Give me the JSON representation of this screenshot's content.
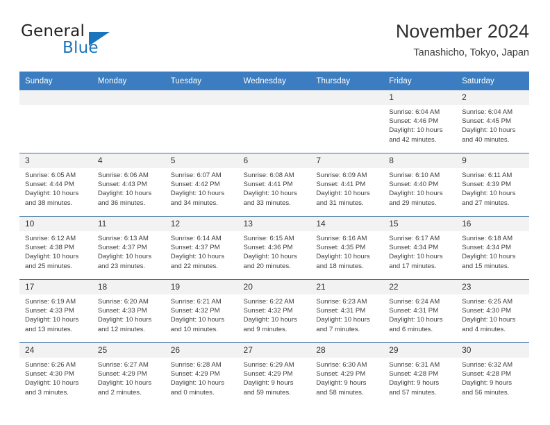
{
  "logo": {
    "word1": "General",
    "word2": "Blue",
    "triangle_color": "#1b75bc"
  },
  "header": {
    "title": "November 2024",
    "location": "Tanashicho, Tokyo, Japan",
    "header_bg": "#3b7dc0",
    "daynum_bg": "#f2f2f2"
  },
  "weekdays": [
    "Sunday",
    "Monday",
    "Tuesday",
    "Wednesday",
    "Thursday",
    "Friday",
    "Saturday"
  ],
  "weeks": [
    [
      {
        "day": "",
        "sunrise": "",
        "sunset": "",
        "daylight": "",
        "daylight2": "",
        "empty": true
      },
      {
        "day": "",
        "sunrise": "",
        "sunset": "",
        "daylight": "",
        "daylight2": "",
        "empty": true
      },
      {
        "day": "",
        "sunrise": "",
        "sunset": "",
        "daylight": "",
        "daylight2": "",
        "empty": true
      },
      {
        "day": "",
        "sunrise": "",
        "sunset": "",
        "daylight": "",
        "daylight2": "",
        "empty": true
      },
      {
        "day": "",
        "sunrise": "",
        "sunset": "",
        "daylight": "",
        "daylight2": "",
        "empty": true
      },
      {
        "day": "1",
        "sunrise": "Sunrise: 6:04 AM",
        "sunset": "Sunset: 4:46 PM",
        "daylight": "Daylight: 10 hours",
        "daylight2": "and 42 minutes.",
        "empty": false
      },
      {
        "day": "2",
        "sunrise": "Sunrise: 6:04 AM",
        "sunset": "Sunset: 4:45 PM",
        "daylight": "Daylight: 10 hours",
        "daylight2": "and 40 minutes.",
        "empty": false
      }
    ],
    [
      {
        "day": "3",
        "sunrise": "Sunrise: 6:05 AM",
        "sunset": "Sunset: 4:44 PM",
        "daylight": "Daylight: 10 hours",
        "daylight2": "and 38 minutes.",
        "empty": false
      },
      {
        "day": "4",
        "sunrise": "Sunrise: 6:06 AM",
        "sunset": "Sunset: 4:43 PM",
        "daylight": "Daylight: 10 hours",
        "daylight2": "and 36 minutes.",
        "empty": false
      },
      {
        "day": "5",
        "sunrise": "Sunrise: 6:07 AM",
        "sunset": "Sunset: 4:42 PM",
        "daylight": "Daylight: 10 hours",
        "daylight2": "and 34 minutes.",
        "empty": false
      },
      {
        "day": "6",
        "sunrise": "Sunrise: 6:08 AM",
        "sunset": "Sunset: 4:41 PM",
        "daylight": "Daylight: 10 hours",
        "daylight2": "and 33 minutes.",
        "empty": false
      },
      {
        "day": "7",
        "sunrise": "Sunrise: 6:09 AM",
        "sunset": "Sunset: 4:41 PM",
        "daylight": "Daylight: 10 hours",
        "daylight2": "and 31 minutes.",
        "empty": false
      },
      {
        "day": "8",
        "sunrise": "Sunrise: 6:10 AM",
        "sunset": "Sunset: 4:40 PM",
        "daylight": "Daylight: 10 hours",
        "daylight2": "and 29 minutes.",
        "empty": false
      },
      {
        "day": "9",
        "sunrise": "Sunrise: 6:11 AM",
        "sunset": "Sunset: 4:39 PM",
        "daylight": "Daylight: 10 hours",
        "daylight2": "and 27 minutes.",
        "empty": false
      }
    ],
    [
      {
        "day": "10",
        "sunrise": "Sunrise: 6:12 AM",
        "sunset": "Sunset: 4:38 PM",
        "daylight": "Daylight: 10 hours",
        "daylight2": "and 25 minutes.",
        "empty": false
      },
      {
        "day": "11",
        "sunrise": "Sunrise: 6:13 AM",
        "sunset": "Sunset: 4:37 PM",
        "daylight": "Daylight: 10 hours",
        "daylight2": "and 23 minutes.",
        "empty": false
      },
      {
        "day": "12",
        "sunrise": "Sunrise: 6:14 AM",
        "sunset": "Sunset: 4:37 PM",
        "daylight": "Daylight: 10 hours",
        "daylight2": "and 22 minutes.",
        "empty": false
      },
      {
        "day": "13",
        "sunrise": "Sunrise: 6:15 AM",
        "sunset": "Sunset: 4:36 PM",
        "daylight": "Daylight: 10 hours",
        "daylight2": "and 20 minutes.",
        "empty": false
      },
      {
        "day": "14",
        "sunrise": "Sunrise: 6:16 AM",
        "sunset": "Sunset: 4:35 PM",
        "daylight": "Daylight: 10 hours",
        "daylight2": "and 18 minutes.",
        "empty": false
      },
      {
        "day": "15",
        "sunrise": "Sunrise: 6:17 AM",
        "sunset": "Sunset: 4:34 PM",
        "daylight": "Daylight: 10 hours",
        "daylight2": "and 17 minutes.",
        "empty": false
      },
      {
        "day": "16",
        "sunrise": "Sunrise: 6:18 AM",
        "sunset": "Sunset: 4:34 PM",
        "daylight": "Daylight: 10 hours",
        "daylight2": "and 15 minutes.",
        "empty": false
      }
    ],
    [
      {
        "day": "17",
        "sunrise": "Sunrise: 6:19 AM",
        "sunset": "Sunset: 4:33 PM",
        "daylight": "Daylight: 10 hours",
        "daylight2": "and 13 minutes.",
        "empty": false
      },
      {
        "day": "18",
        "sunrise": "Sunrise: 6:20 AM",
        "sunset": "Sunset: 4:33 PM",
        "daylight": "Daylight: 10 hours",
        "daylight2": "and 12 minutes.",
        "empty": false
      },
      {
        "day": "19",
        "sunrise": "Sunrise: 6:21 AM",
        "sunset": "Sunset: 4:32 PM",
        "daylight": "Daylight: 10 hours",
        "daylight2": "and 10 minutes.",
        "empty": false
      },
      {
        "day": "20",
        "sunrise": "Sunrise: 6:22 AM",
        "sunset": "Sunset: 4:32 PM",
        "daylight": "Daylight: 10 hours",
        "daylight2": "and 9 minutes.",
        "empty": false
      },
      {
        "day": "21",
        "sunrise": "Sunrise: 6:23 AM",
        "sunset": "Sunset: 4:31 PM",
        "daylight": "Daylight: 10 hours",
        "daylight2": "and 7 minutes.",
        "empty": false
      },
      {
        "day": "22",
        "sunrise": "Sunrise: 6:24 AM",
        "sunset": "Sunset: 4:31 PM",
        "daylight": "Daylight: 10 hours",
        "daylight2": "and 6 minutes.",
        "empty": false
      },
      {
        "day": "23",
        "sunrise": "Sunrise: 6:25 AM",
        "sunset": "Sunset: 4:30 PM",
        "daylight": "Daylight: 10 hours",
        "daylight2": "and 4 minutes.",
        "empty": false
      }
    ],
    [
      {
        "day": "24",
        "sunrise": "Sunrise: 6:26 AM",
        "sunset": "Sunset: 4:30 PM",
        "daylight": "Daylight: 10 hours",
        "daylight2": "and 3 minutes.",
        "empty": false
      },
      {
        "day": "25",
        "sunrise": "Sunrise: 6:27 AM",
        "sunset": "Sunset: 4:29 PM",
        "daylight": "Daylight: 10 hours",
        "daylight2": "and 2 minutes.",
        "empty": false
      },
      {
        "day": "26",
        "sunrise": "Sunrise: 6:28 AM",
        "sunset": "Sunset: 4:29 PM",
        "daylight": "Daylight: 10 hours",
        "daylight2": "and 0 minutes.",
        "empty": false
      },
      {
        "day": "27",
        "sunrise": "Sunrise: 6:29 AM",
        "sunset": "Sunset: 4:29 PM",
        "daylight": "Daylight: 9 hours",
        "daylight2": "and 59 minutes.",
        "empty": false
      },
      {
        "day": "28",
        "sunrise": "Sunrise: 6:30 AM",
        "sunset": "Sunset: 4:29 PM",
        "daylight": "Daylight: 9 hours",
        "daylight2": "and 58 minutes.",
        "empty": false
      },
      {
        "day": "29",
        "sunrise": "Sunrise: 6:31 AM",
        "sunset": "Sunset: 4:28 PM",
        "daylight": "Daylight: 9 hours",
        "daylight2": "and 57 minutes.",
        "empty": false
      },
      {
        "day": "30",
        "sunrise": "Sunrise: 6:32 AM",
        "sunset": "Sunset: 4:28 PM",
        "daylight": "Daylight: 9 hours",
        "daylight2": "and 56 minutes.",
        "empty": false
      }
    ]
  ]
}
